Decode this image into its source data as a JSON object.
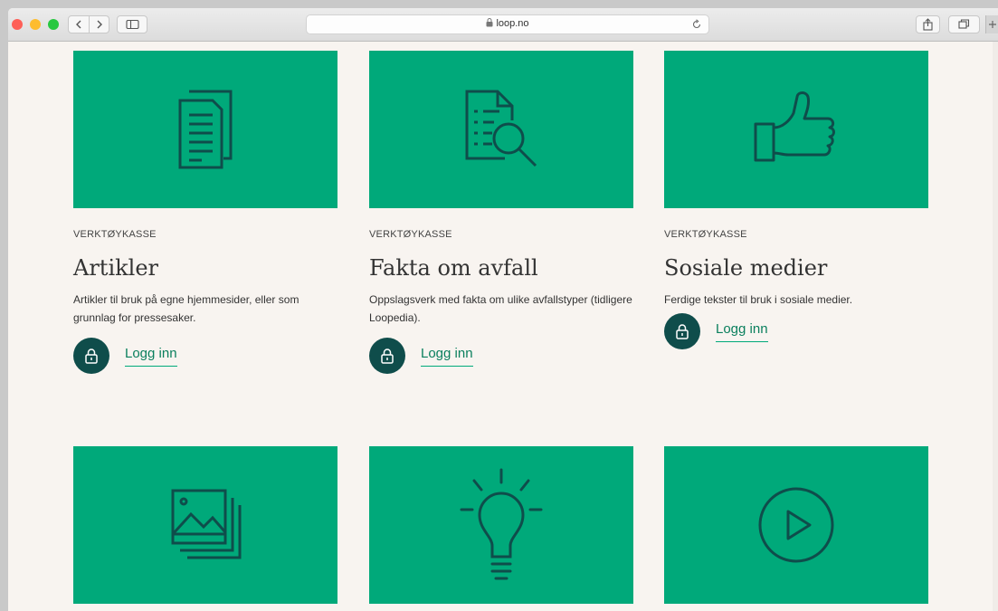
{
  "browser": {
    "url": "loop.no",
    "traffic_light_colors": [
      "#fe5f57",
      "#febc2e",
      "#28c840"
    ],
    "icons": [
      "back-icon",
      "forward-icon",
      "sidebar-icon",
      "lock-icon",
      "reload-icon",
      "share-icon",
      "tabs-icon"
    ]
  },
  "colors": {
    "card_background": "#00a97a",
    "icon_stroke": "#0f4d4b",
    "link": "#0a7f5d",
    "page_background": "#f8f4f0"
  },
  "cards": [
    {
      "icon": "documents-icon",
      "label": "VERKTØYKASSE",
      "title": "Artikler",
      "description": "Artikler til bruk på egne hjemmesider, eller som grunnlag for pressesaker.",
      "login": "Logg inn"
    },
    {
      "icon": "document-search-icon",
      "label": "VERKTØYKASSE",
      "title": "Fakta om avfall",
      "description": "Oppslagsverk med fakta om ulike avfallstyper (tidligere Loopedia).",
      "login": "Logg inn"
    },
    {
      "icon": "thumbs-up-icon",
      "label": "VERKTØYKASSE",
      "title": "Sosiale medier",
      "description": "Ferdige tekster til bruk i sosiale medier.",
      "login": "Logg inn"
    },
    {
      "icon": "images-icon"
    },
    {
      "icon": "lightbulb-icon"
    },
    {
      "icon": "play-icon"
    }
  ]
}
